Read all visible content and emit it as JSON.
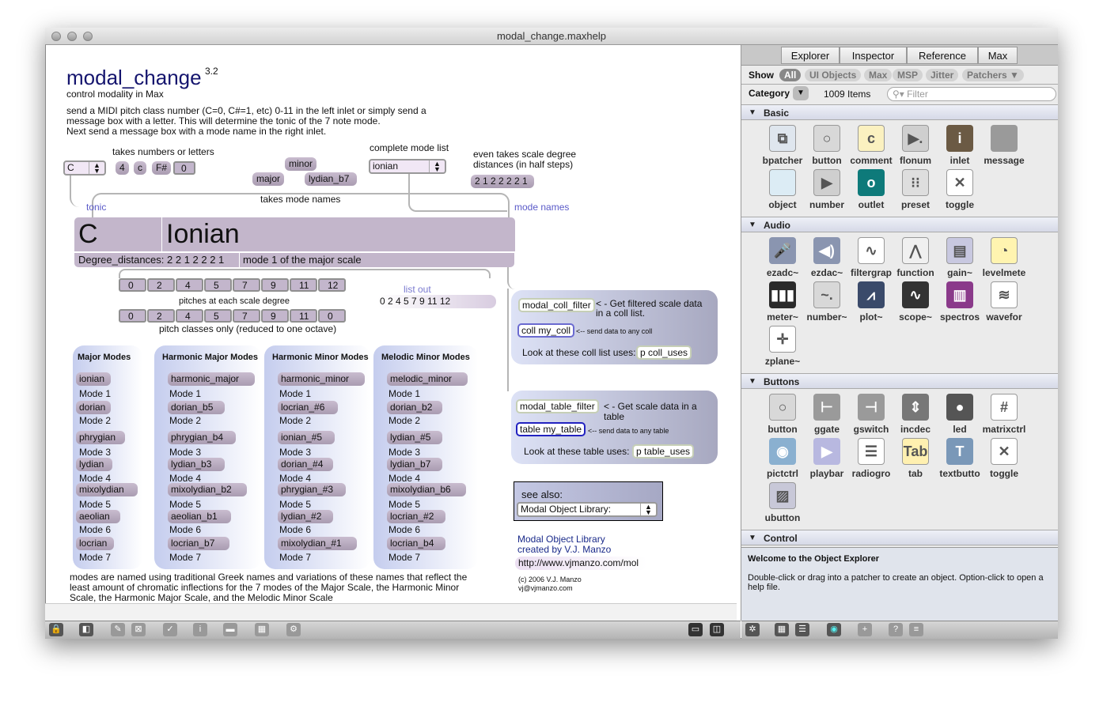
{
  "window": {
    "title": "modal_change.maxhelp"
  },
  "patcher": {
    "title": "modal_change",
    "version": "3.2",
    "subtitle": "control modality in Max",
    "description": [
      "send a MIDI pitch class number (C=0, C#=1, etc) 0-11 in the left inlet or simply send a",
      "message box with a letter. This will determine the tonic of the 7 note mode.",
      "Next send a message box with a mode name in the right inlet."
    ],
    "labels": {
      "takes_numbers": "takes numbers or letters",
      "complete_list": "complete mode list",
      "even_takes": [
        "even takes scale degree",
        "distances (in half steps)"
      ],
      "takes_mode_names": "takes mode names",
      "tonic": "tonic",
      "mode_names": "mode names",
      "pitches_each": "pitches at each scale degree",
      "pitch_classes": "pitch classes only (reduced to one octave)",
      "list_out": "list out"
    },
    "tonic_menu": "C",
    "tonic_msgs": [
      "4",
      "c",
      "F#"
    ],
    "tonic_number": "0",
    "mode_msgs": {
      "minor": "minor",
      "major": "major",
      "lydian_b7": "lydian_b7"
    },
    "mode_menu": "ionian",
    "distance_msg": "2 1 2 2 2 2 1",
    "display": {
      "tonic": "C",
      "mode": "Ionian",
      "degree": "Degree_distances: 2 2 1 2 2 2 1",
      "mode_desc": "mode 1 of the major scale"
    },
    "pitches": [
      "0",
      "2",
      "4",
      "5",
      "7",
      "9",
      "11",
      "12"
    ],
    "pitch_classes": [
      "0",
      "2",
      "4",
      "5",
      "7",
      "9",
      "11",
      "0"
    ],
    "list_out": "0 2 4 5 7 9 11 12",
    "mode_columns": [
      {
        "title": "Major Modes",
        "modes": [
          "ionian",
          "dorian",
          "phrygian",
          "lydian",
          "mixolydian",
          "aeolian",
          "locrian"
        ]
      },
      {
        "title": "Harmonic Major Modes",
        "modes": [
          "harmonic_major",
          "dorian_b5",
          "phrygian_b4",
          "lydian_b3",
          "mixolydian_b2",
          "aeolian_b1",
          "locrian_b7"
        ]
      },
      {
        "title": "Harmonic Minor Modes",
        "modes": [
          "harmonic_minor",
          "locrian_#6",
          "ionian_#5",
          "dorian_#4",
          "phrygian_#3",
          "lydian_#2",
          "mixolydian_#1"
        ]
      },
      {
        "title": "Melodic Minor Modes",
        "modes": [
          "melodic_minor",
          "dorian_b2",
          "lydian_#5",
          "lydian_b7",
          "mixolydian_b6",
          "locrian_#2",
          "locrian_b4"
        ]
      }
    ],
    "mode_labels": [
      "Mode 1",
      "Mode 2",
      "Mode 3",
      "Mode 4",
      "Mode 5",
      "Mode 6",
      "Mode 7"
    ],
    "footer": [
      "modes are named using traditional Greek names and variations of these names that reflect the",
      "least amount of chromatic inflections for the 7 modes of the Major Scale, the Harmonic Minor",
      "Scale, the Harmonic Major Scale, and the Melodic Minor Scale"
    ],
    "coll": {
      "filter": "modal_coll_filter",
      "filter_note": [
        "< - Get filtered scale data",
        "in a coll list."
      ],
      "coll": "coll my_coll",
      "coll_note": "<-- send data to any coll",
      "uses_label": "Look at these coll list uses:",
      "uses": "p coll_uses"
    },
    "table": {
      "filter": "modal_table_filter",
      "filter_note": [
        "< - Get scale data in a",
        "table"
      ],
      "table": "table my_table",
      "table_note": "<-- send data to any table",
      "uses_label": "Look at these table uses:",
      "uses": "p table_uses"
    },
    "see_also": {
      "label": "see also:",
      "menu": "Modal Object Library:"
    },
    "credits": {
      "line1": "Modal Object Library",
      "line2": "created by V.J. Manzo",
      "url": "http://www.vjmanzo.com/mol",
      "copyright": "(c) 2006 V.J. Manzo",
      "email": "vj@vjmanzo.com"
    }
  },
  "explorer": {
    "tabs": [
      "Explorer",
      "Inspector",
      "Reference",
      "Max"
    ],
    "show_label": "Show",
    "filters": [
      "All",
      "UI Objects",
      "Max",
      "MSP",
      "Jitter",
      "Patchers ▼"
    ],
    "category_label": "Category",
    "item_count": "1009 Items",
    "filter_placeholder": "Filter",
    "sections": [
      {
        "name": "Basic",
        "items": [
          [
            "bpatcher",
            "#dfe6ee",
            "⧉"
          ],
          [
            "button",
            "#d8d8d8",
            "○"
          ],
          [
            "comment",
            "#fbf1c0",
            "c"
          ],
          [
            "flonum",
            "#cfcfcf",
            "▶."
          ],
          [
            "inlet",
            "#6b5a44",
            "i"
          ],
          [
            "message",
            "#9a9a9a",
            ""
          ],
          [
            "object",
            "#dcecf5",
            ""
          ],
          [
            "number",
            "#cfcfcf",
            "▶"
          ],
          [
            "outlet",
            "#0e7a7a",
            "o"
          ],
          [
            "preset",
            "#dedede",
            "⁝⁝"
          ],
          [
            "toggle",
            "#ffffff",
            "✕"
          ]
        ]
      },
      {
        "name": "Audio",
        "items": [
          [
            "ezadc~",
            "#8a95b0",
            "🎤"
          ],
          [
            "ezdac~",
            "#8a95b0",
            "◀)"
          ],
          [
            "filtergrap",
            "#ffffff",
            "∿"
          ],
          [
            "function",
            "#f0f0f0",
            "⋀"
          ],
          [
            "gain~",
            "#c8c8e0",
            "▤"
          ],
          [
            "levelmete",
            "#fff4b0",
            "◔"
          ],
          [
            "meter~",
            "#2a2a2a",
            "▮▮▮"
          ],
          [
            "number~",
            "#d8d8d8",
            "~."
          ],
          [
            "plot~",
            "#3a4a6a",
            "⩘"
          ],
          [
            "scope~",
            "#333333",
            "∿"
          ],
          [
            "spectros",
            "#8a3a8a",
            "▥"
          ],
          [
            "wavefor",
            "#ffffff",
            "≋"
          ],
          [
            "zplane~",
            "#ffffff",
            "✛"
          ]
        ]
      },
      {
        "name": "Buttons",
        "items": [
          [
            "button",
            "#d8d8d8",
            "○"
          ],
          [
            "ggate",
            "#9a9a9a",
            "⊢"
          ],
          [
            "gswitch",
            "#9a9a9a",
            "⊣"
          ],
          [
            "incdec",
            "#777777",
            "⇕"
          ],
          [
            "led",
            "#555555",
            "●"
          ],
          [
            "matrixctrl",
            "#ffffff",
            "#"
          ],
          [
            "pictctrl",
            "#8ab0d0",
            "◉"
          ],
          [
            "playbar",
            "#b8b8e0",
            "▶"
          ],
          [
            "radiogro",
            "#ffffff",
            "☰"
          ],
          [
            "tab",
            "#fff0b0",
            "Tab"
          ],
          [
            "textbutto",
            "#7a98b8",
            "T"
          ],
          [
            "toggle",
            "#ffffff",
            "✕"
          ],
          [
            "ubutton",
            "#c8c8d8",
            "▨"
          ]
        ]
      },
      {
        "name": "Control",
        "items": []
      }
    ],
    "welcome_title": "Welcome to the Object Explorer",
    "welcome_text": "Double-click or drag into a patcher to create an object. Option-click to open a help file."
  },
  "toolbar": {
    "left_icons": [
      "lock-icon",
      "presentation-icon",
      "edit-icon",
      "clear-icon",
      "inspector-icon",
      "info-icon",
      "object-icon",
      "grid-icon",
      "debug-icon"
    ],
    "right_icons": [
      "split-view-icon",
      "sidebar-icon"
    ],
    "explorer_icons": [
      "gear-icon",
      "grid-view-icon",
      "list-view-icon",
      "preview-icon",
      "add-icon",
      "help-icon",
      "menu-icon"
    ]
  }
}
